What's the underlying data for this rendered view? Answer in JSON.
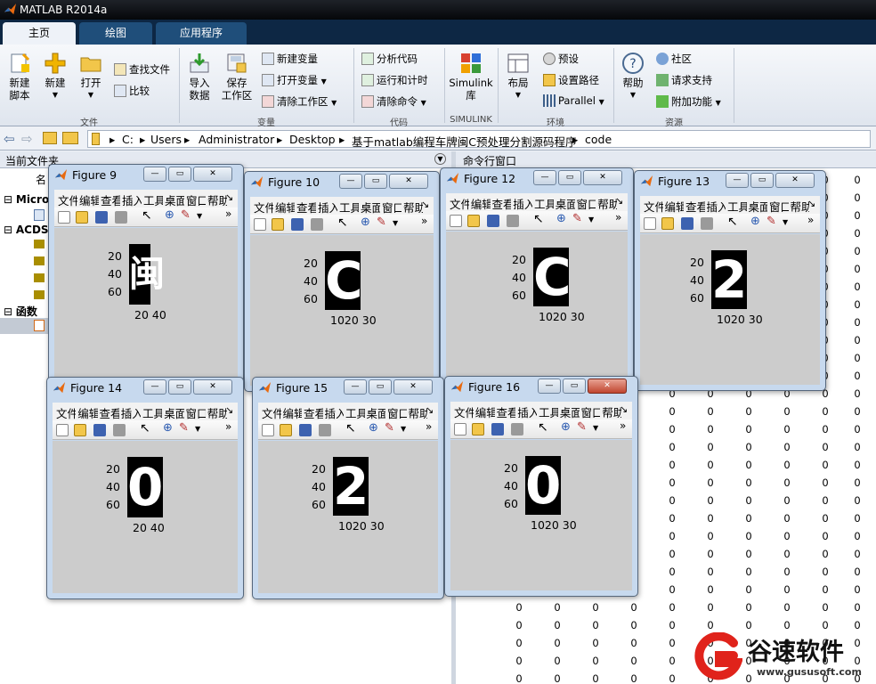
{
  "window": {
    "title": "MATLAB R2014a"
  },
  "tabs": [
    "主页",
    "绘图",
    "应用程序"
  ],
  "ribbon": {
    "groups": [
      "文件",
      "变量",
      "代码",
      "SIMULINK",
      "环境",
      "资源"
    ],
    "new_script": "新建\n脚本",
    "new": "新建",
    "open": "打开",
    "find_files": "查找文件",
    "compare": "比较",
    "import_data": "导入\n数据",
    "save_workspace": "保存\n工作区",
    "new_variable": "新建变量",
    "open_variable": "打开变量",
    "clear_workspace": "清除工作区",
    "analyze_code": "分析代码",
    "run_and_time": "运行和计时",
    "clear_commands": "清除命令",
    "simulink": "Simulink\n库",
    "layout": "布局",
    "preferences": "预设",
    "set_path": "设置路径",
    "parallel": "Parallel",
    "help": "帮助",
    "community": "社区",
    "request_support": "请求支持",
    "addons": "附加功能"
  },
  "address": {
    "segments": [
      "C:",
      "Users",
      "Administrator",
      "Desktop",
      "基于matlab编程车牌闽C预处理分割源码程序",
      "code"
    ]
  },
  "left_panel": {
    "title": "当前文件夹",
    "col_name": "名",
    "items": [
      "Micro",
      "ACDS",
      "函数"
    ]
  },
  "command_window": {
    "title": "命令行窗口",
    "value": "0"
  },
  "figure_menu": [
    "文件",
    "编辑",
    "查看",
    "插入",
    "工具",
    "桌面",
    "窗口",
    "帮助"
  ],
  "figures": [
    {
      "title": "Figure 9",
      "y_ticks": [
        "20",
        "40",
        "60"
      ],
      "x_ticks": "20 40",
      "glyph": "闽"
    },
    {
      "title": "Figure 10",
      "y_ticks": [
        "20",
        "40",
        "60"
      ],
      "x_ticks": "1020 30",
      "glyph": "C"
    },
    {
      "title": "Figure 12",
      "y_ticks": [
        "20",
        "40",
        "60"
      ],
      "x_ticks": "1020 30",
      "glyph": "C"
    },
    {
      "title": "Figure 13",
      "y_ticks": [
        "20",
        "40",
        "60"
      ],
      "x_ticks": "1020 30",
      "glyph": "2"
    },
    {
      "title": "Figure 14",
      "y_ticks": [
        "20",
        "40",
        "60"
      ],
      "x_ticks": "20 40",
      "glyph": "0"
    },
    {
      "title": "Figure 15",
      "y_ticks": [
        "20",
        "40",
        "60"
      ],
      "x_ticks": "1020 30",
      "glyph": "2"
    },
    {
      "title": "Figure 16",
      "y_ticks": [
        "20",
        "40",
        "60"
      ],
      "x_ticks": "1020 30",
      "glyph": "0"
    }
  ],
  "watermark": {
    "name": "谷速软件",
    "url": "www.gususoft.com"
  },
  "colors": {
    "titlebar": "#0b0d10",
    "tabstrip": "#0d2744",
    "accent": "#f08c00",
    "brand_red": "#e0231b"
  }
}
